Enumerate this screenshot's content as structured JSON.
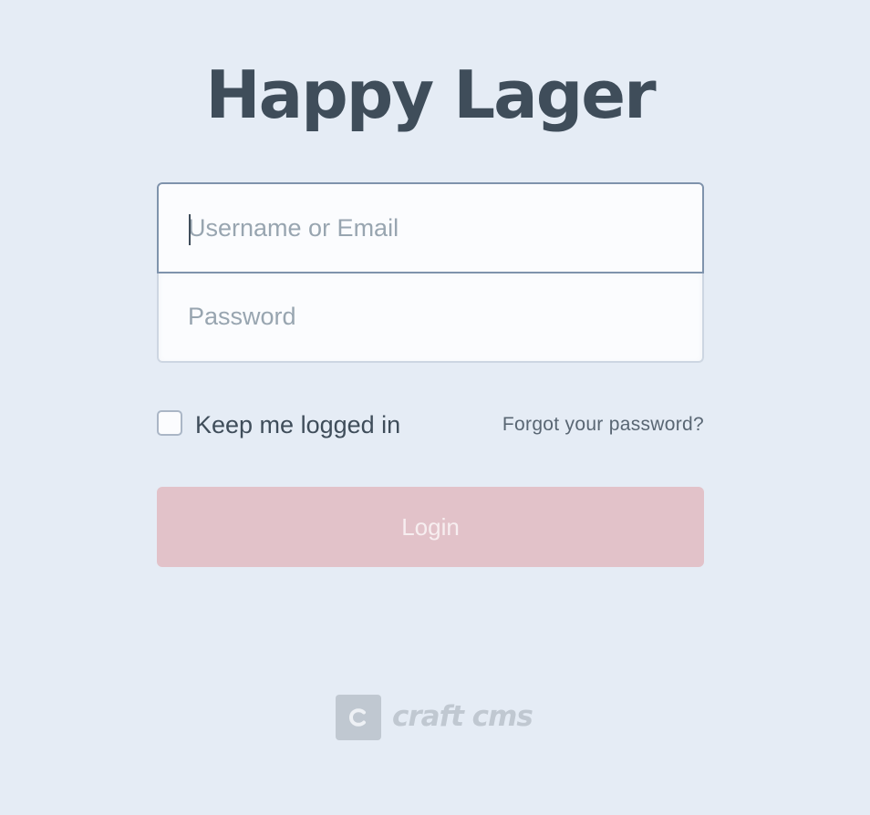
{
  "site": {
    "title": "Happy Lager"
  },
  "login": {
    "username_placeholder": "Username or Email",
    "password_placeholder": "Password",
    "remember_label": "Keep me logged in",
    "forgot_label": "Forgot your password?",
    "submit_label": "Login",
    "remember_checked": false
  },
  "footer": {
    "brand_letter": "c",
    "brand_name": "craft cms"
  },
  "colors": {
    "background": "#e5ecf5",
    "title": "#3f4d5a",
    "login_button": "#e2c2c9",
    "brand": "#c0c8d1"
  },
  "icons": {
    "brand_logo": "craft-logo-icon"
  }
}
